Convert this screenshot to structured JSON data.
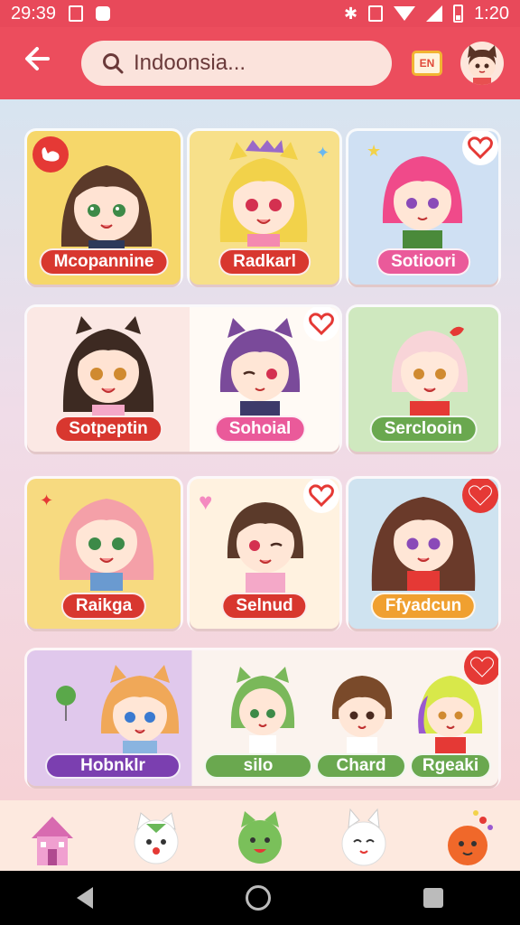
{
  "status_bar": {
    "time_left": "29:39",
    "time_right": "1:20"
  },
  "header": {
    "search_text": "Indoonsia...",
    "lang_badge": "EN"
  },
  "cards": [
    {
      "label": "Mcopannine",
      "label_color": "#d8372f",
      "bg": "#f6d76a"
    },
    {
      "label": "Radkarl",
      "label_color": "#d8372f",
      "bg": "#f7e08a"
    },
    {
      "label": "Sotioori",
      "label_color": "#ea5a9a",
      "bg": "#cfe0f3"
    },
    {
      "label": "Sotpeptin",
      "label_color": "#d8372f",
      "bg": "#fbe8e4"
    },
    {
      "label": "Sohoial",
      "label_color": "#ea5a9a",
      "bg": "#fffaf5"
    },
    {
      "label": "Serclooin",
      "label_color": "#6aa84f",
      "bg": "#cfe8bf"
    },
    {
      "label": "Raikga",
      "label_color": "#d8372f",
      "bg": "#f7da80"
    },
    {
      "label": "Selnud",
      "label_color": "#d8372f",
      "bg": "#fff2e0"
    },
    {
      "label": "Ffyadcun",
      "label_color": "#f0a030",
      "bg": "#cfe3f0"
    }
  ],
  "wide_card": {
    "labels": [
      {
        "text": "Hobnklr",
        "color": "#7b3fb0"
      },
      {
        "text": "silo",
        "color": "#6aa84f"
      },
      {
        "text": "Chard",
        "color": "#6aa84f"
      },
      {
        "text": "Rgeaki",
        "color": "#6aa84f"
      }
    ]
  },
  "dock": [
    "house-icon",
    "white-cat-icon",
    "green-cat-icon",
    "white-bunny-icon",
    "orange-blob-icon"
  ]
}
